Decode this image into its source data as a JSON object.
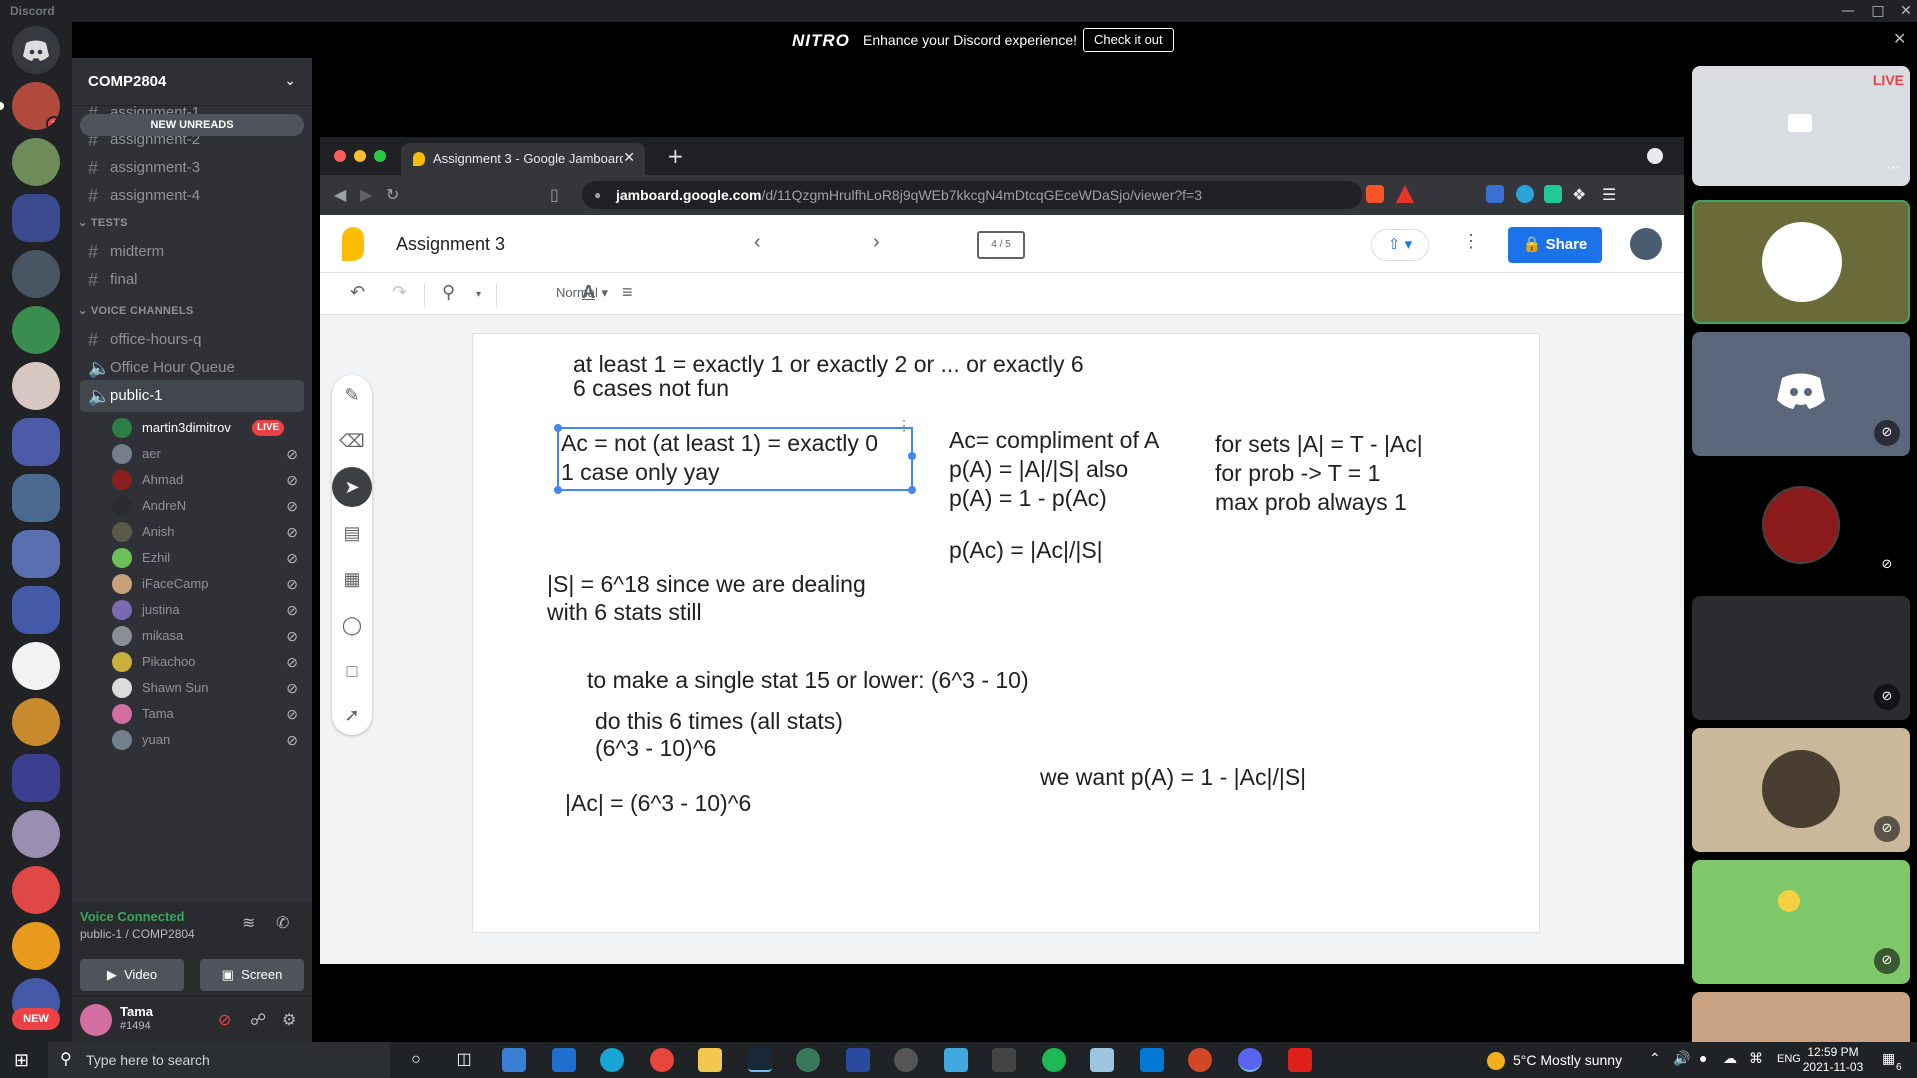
{
  "app": {
    "name": "Discord"
  },
  "nitro": {
    "logo": "NITRO",
    "message": "Enhance your Discord experience!",
    "cta": "Check it out"
  },
  "rail": {
    "mention_count": "1",
    "new_label": "NEW"
  },
  "guild": {
    "name": "COMP2804"
  },
  "channels": {
    "new_unreads": "NEW UNREADS",
    "partial_top": "assignment-1",
    "text": [
      "assignment-2",
      "assignment-3",
      "assignment-4"
    ],
    "tests_category": "TESTS",
    "tests": [
      "midterm",
      "final"
    ],
    "voice_category": "VOICE CHANNELS",
    "voice_text": "office-hours-q",
    "voice": [
      "Office Hour Queue",
      "public-1"
    ]
  },
  "voice_users": [
    {
      "name": "martin3dimitrov",
      "live": "LIVE"
    },
    {
      "name": "aer"
    },
    {
      "name": "Ahmad"
    },
    {
      "name": "AndreN"
    },
    {
      "name": "Anish"
    },
    {
      "name": "Ezhil"
    },
    {
      "name": "iFaceCamp"
    },
    {
      "name": "justina"
    },
    {
      "name": "mikasa"
    },
    {
      "name": "Pikachoo"
    },
    {
      "name": "Shawn Sun"
    },
    {
      "name": "Tama"
    },
    {
      "name": "yuan"
    }
  ],
  "voice_status": {
    "title": "Voice Connected",
    "channel": "public-1 / COMP2804",
    "video": "Video",
    "screen": "Screen"
  },
  "user": {
    "name": "Tama",
    "tag": "#1494"
  },
  "browser": {
    "tab_title": "Assignment 3 - Google Jamboard",
    "url_host": "jamboard.google.com",
    "url_path": "/d/11QzgmHrulfhLoR8j9qWEb7kkcgN4mDtcqGEceWDaSjo/viewer?f=3"
  },
  "jamboard": {
    "title": "Assignment 3",
    "frame": "4 / 5",
    "share": "Share",
    "font_style": "Normal"
  },
  "notes": {
    "n1": "at least 1 = exactly 1 or exactly 2 or ... or exactly 6",
    "n2": "6 cases not fun",
    "n3a": "Ac = not (at least 1) = exactly 0",
    "n3b": "1 case only yay",
    "n4a": "Ac= compliment of A",
    "n4b": "p(A) = |A|/|S| also",
    "n4c": "p(A) = 1 - p(Ac)",
    "n5a": "for sets |A| = T - |Ac|",
    "n5b": "for prob -> T = 1",
    "n5c": "max prob always 1",
    "n6": "p(Ac) = |Ac|/|S|",
    "n7a": "|S| = 6^18 since we are dealing",
    "n7b": "with 6 stats still",
    "n8": "to make a single stat 15 or lower: (6^3 - 10)",
    "n9a": "do this 6 times (all stats)",
    "n9b": "(6^3 - 10)^6",
    "n10": "we want p(A) = 1 - |Ac|/|S|",
    "n11": "|Ac| = (6^3 - 10)^6"
  },
  "tiles": {
    "live": "LIVE"
  },
  "taskbar": {
    "search_placeholder": "Type here to search",
    "weather": "5°C  Mostly sunny",
    "lang": "ENG",
    "time": "12:59 PM",
    "date": "2021-11-03",
    "notif_count": "6"
  },
  "colors": {
    "discord_bg": "#2f3136",
    "rail": "#202225",
    "accent": "#5865f2",
    "green": "#3ba55d",
    "red": "#ed4245",
    "share": "#1a73e8"
  }
}
